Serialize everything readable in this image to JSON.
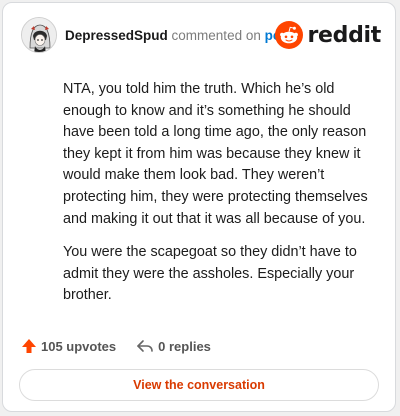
{
  "header": {
    "username": "DepressedSpud",
    "action_text": "commented on",
    "post_link": "post",
    "brand": "reddit"
  },
  "comment": {
    "paragraphs": [
      "NTA, you told him the truth. Which he’s old enough to know and it’s something he should have been told a long time ago, the only reason they kept it from him was because they knew it would make them look bad. They weren’t protecting him, they were protecting themselves and making it out that it was all because of you.",
      "You were the scapegoat so they didn’t have to admit they were the assholes. Especially your brother."
    ]
  },
  "actions": {
    "upvotes_label": "105 upvotes",
    "replies_label": "0 replies"
  },
  "cta": {
    "label": "View the conversation"
  },
  "icons": {
    "avatar": "anime-avatar-icon",
    "logo": "reddit-snoo-icon",
    "upvote": "arrow-up-icon",
    "reply": "reply-arrow-icon"
  },
  "colors": {
    "brand": "#ff4500",
    "link": "#0079d3",
    "cta_text": "#d93a00"
  }
}
